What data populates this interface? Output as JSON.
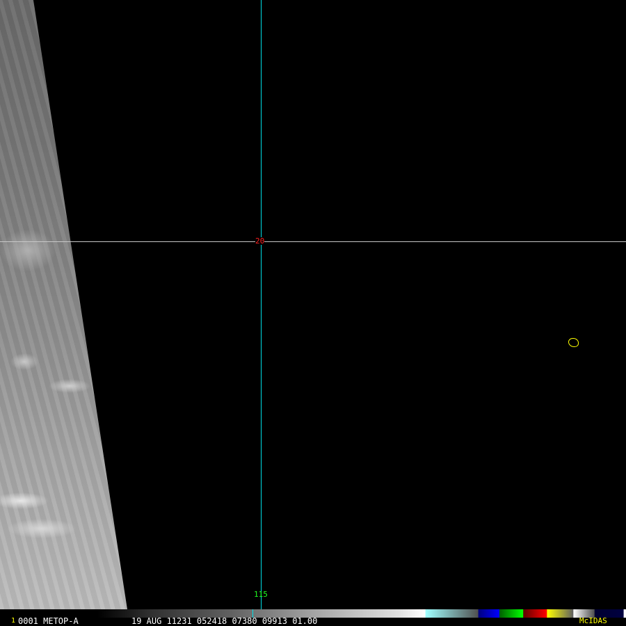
{
  "image": {
    "lat_label": "20",
    "lon_label": "115"
  },
  "status_bar": {
    "frame_number": "1",
    "satellite": "0001 METOP-A",
    "datetime_info": "19 AUG 11231 052418 07380 09913 01.00",
    "brand": "McIDAS"
  }
}
